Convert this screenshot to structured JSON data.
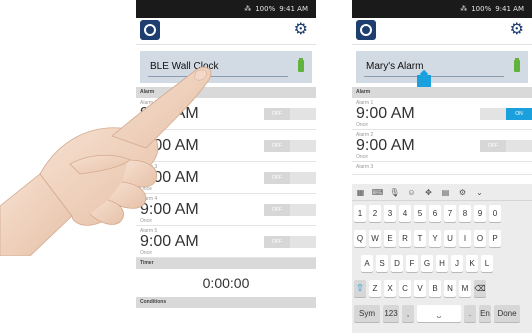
{
  "status_bar": {
    "signal": "⁂",
    "battery_percent": "100%",
    "time": "9:41 AM"
  },
  "left_screen": {
    "device_name": "BLE Wall Clock",
    "alarm_section": "Alarm",
    "alarms": [
      {
        "label": "Alarm 1",
        "time": "9:00 AM",
        "repeat": "Once",
        "state": "OFF"
      },
      {
        "label": "Alarm 2",
        "time": "9:00 AM",
        "repeat": "Once",
        "state": "OFF"
      },
      {
        "label": "Alarm 3",
        "time": "9:00 AM",
        "repeat": "Once",
        "state": "OFF"
      },
      {
        "label": "Alarm 4",
        "time": "9:00 AM",
        "repeat": "Once",
        "state": "OFF"
      },
      {
        "label": "Alarm 5",
        "time": "9:00 AM",
        "repeat": "Once",
        "state": "OFF"
      }
    ],
    "timer_section": "Timer",
    "timer_value": "0:00:00",
    "next_section": "Conditions"
  },
  "right_screen": {
    "device_name": "Mary's Alarm",
    "alarm_section": "Alarm",
    "alarms": [
      {
        "label": "Alarm 1",
        "time": "9:00 AM",
        "repeat": "Once",
        "state": "ON"
      },
      {
        "label": "Alarm 2",
        "time": "9:00 AM",
        "repeat": "Once",
        "state": "OFF"
      },
      {
        "label": "Alarm 3"
      }
    ]
  },
  "keyboard": {
    "toolbar": [
      "▦",
      "⌨",
      "🎙",
      "☺",
      "✥",
      "▤",
      "⚙",
      "⌄"
    ],
    "number_row": [
      "1",
      "2",
      "3",
      "4",
      "5",
      "6",
      "7",
      "8",
      "9",
      "0"
    ],
    "row_q": [
      "Q",
      "W",
      "E",
      "R",
      "T",
      "Y",
      "U",
      "I",
      "O",
      "P"
    ],
    "row_a": [
      "A",
      "S",
      "D",
      "F",
      "G",
      "H",
      "J",
      "K",
      "L"
    ],
    "row_z": [
      "Z",
      "X",
      "C",
      "V",
      "B",
      "N",
      "M"
    ],
    "shift": "⇧",
    "backspace": "⌫",
    "sym": "Sym",
    "num": "123",
    "comma": ",",
    "space": "⎵",
    "period": ".",
    "lang": "En",
    "done": "Done"
  },
  "colors": {
    "accent": "#1aa0dc",
    "brand": "#1d3e6e",
    "battery": "#62b33d",
    "skin": "#f0d3bf"
  }
}
